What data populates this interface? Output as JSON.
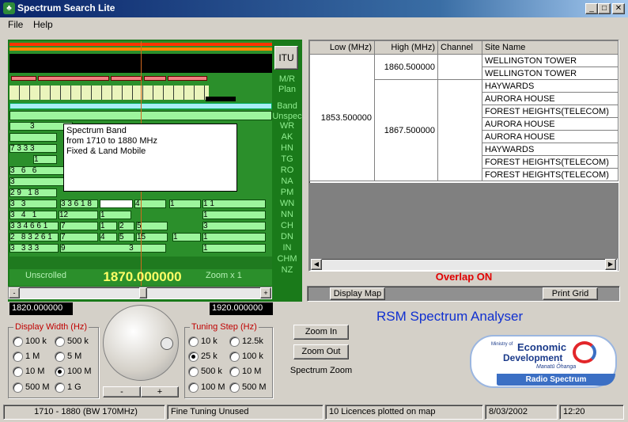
{
  "window": {
    "title": "Spectrum Search Lite",
    "icon": "app-tree-icon"
  },
  "menu": {
    "file": "File",
    "help": "Help"
  },
  "spectrum": {
    "itu": "ITU",
    "labels": [
      "M/R",
      "Plan",
      "Band",
      "Unspec",
      "WR",
      "AK",
      "HN",
      "TG",
      "RO",
      "NA",
      "PM",
      "WN",
      "NN",
      "CH",
      "DN",
      "IN",
      "CHM",
      "NZ"
    ],
    "tooltip": {
      "line1": "Spectrum Band",
      "line2": "from 1710 to 1880 MHz",
      "line3": "Fixed & Land Mobile"
    },
    "unscrolled": "Unscrolled",
    "center_freq": "1870.000000",
    "zoom": "Zoom x 1",
    "min_freq": "1820.000000",
    "max_freq": "1920.000000"
  },
  "display_width": {
    "title": "Display Width (Hz)",
    "options": [
      "100 k",
      "500 k",
      "1 M",
      "5 M",
      "10 M",
      "100 M",
      "500 M",
      "1 G"
    ],
    "selected": "100 M"
  },
  "tuning_step": {
    "title": "Tuning Step (Hz)",
    "options": [
      "10 k",
      "12.5k",
      "25 k",
      "100 k",
      "500 k",
      "10 M",
      "100 M",
      "500 M"
    ],
    "selected": "25 k"
  },
  "dial": {
    "minus": "-",
    "plus": "+"
  },
  "zoom": {
    "in": "Zoom In",
    "out": "Zoom Out",
    "caption": "Spectrum Zoom"
  },
  "grid": {
    "headers": [
      "Low (MHz)",
      "High (MHz)",
      "Channel",
      "Site Name"
    ],
    "low": "1853.500000",
    "high1": "1860.500000",
    "high2": "1867.500000",
    "sites": [
      "WELLINGTON TOWER",
      "WELLINGTON TOWER",
      "HAYWARDS",
      "AURORA HOUSE",
      "FOREST HEIGHTS(TELECOM)",
      "AURORA HOUSE",
      "AURORA HOUSE",
      "HAYWARDS",
      "FOREST HEIGHTS(TELECOM)",
      "FOREST HEIGHTS(TELECOM)"
    ]
  },
  "overlap": "Overlap ON",
  "buttons": {
    "display_map": "Display Map",
    "print_grid": "Print Grid"
  },
  "app_title": "RSM Spectrum Analyser",
  "logo": {
    "ministry": "Ministry of",
    "economic": "Economic",
    "development": "Development",
    "maori": "Manatū Ōhanga",
    "radio": "Radio Spectrum"
  },
  "status": {
    "band": "1710 - 1880 (BW 170MHz)",
    "tuning": "Fine Tuning Unused",
    "licences": "10 Licences plotted on map",
    "date": "8/03/2002",
    "time": "12:20"
  }
}
